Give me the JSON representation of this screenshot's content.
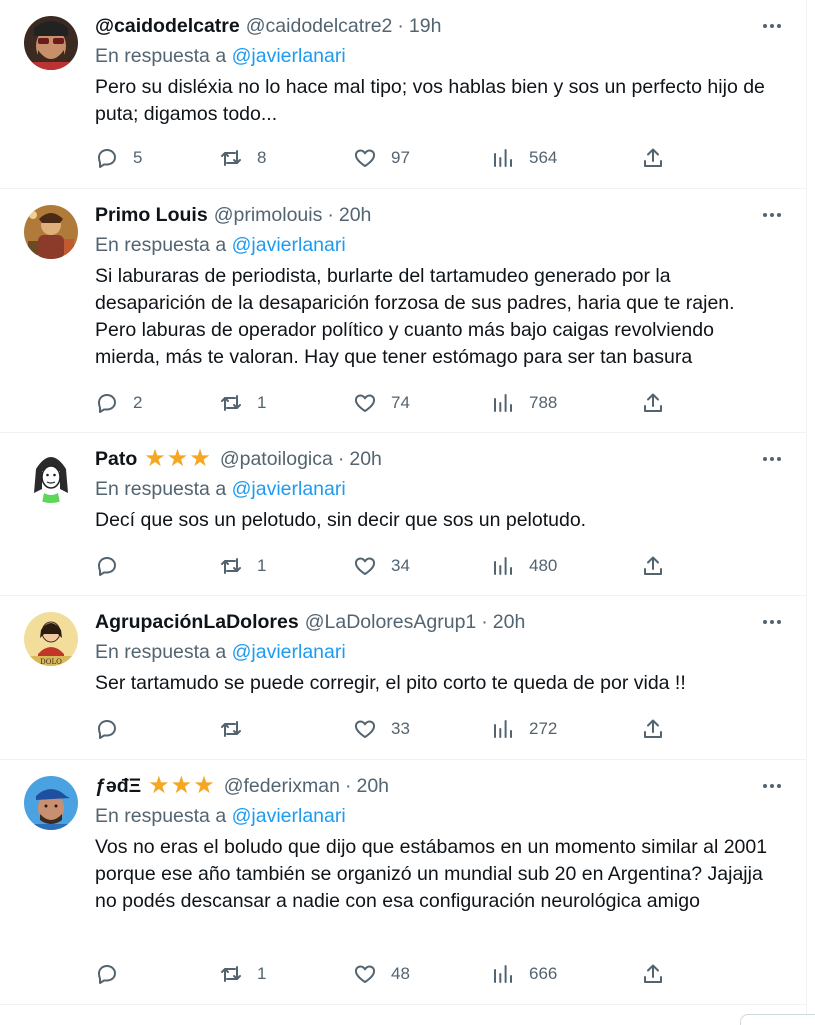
{
  "reply_prefix": "En respuesta a",
  "reply_target": "@javierlanari",
  "tweets": [
    {
      "name": "@caidodelcatre",
      "handle": "@caidodelcatre2",
      "time": "19h",
      "stars": 0,
      "text": "Pero su disléxia no lo hace mal tipo; vos hablas bien y sos un perfecto hijo de puta; digamos todo...",
      "replies": "5",
      "retweets": "8",
      "likes": "97",
      "views": "564",
      "avatar_icon": "man-with-beard-avatar"
    },
    {
      "name": "Primo Louis",
      "handle": "@primolouis",
      "time": "20h",
      "stars": 0,
      "text": "Si laburaras de periodista, burlarte del tartamudeo generado por la desaparición de la desaparición forzosa de sus padres, haria que te rajen. Pero laburas de operador político y cuanto más bajo caigas revolviendo mierda, más te valoran. Hay que tener estómago para ser tan basura",
      "replies": "2",
      "retweets": "1",
      "likes": "74",
      "views": "788",
      "avatar_icon": "illustrated-figure-avatar"
    },
    {
      "name": "Pato",
      "handle": "@patoilogica",
      "time": "20h",
      "stars": 3,
      "text": "Decí que sos un pelotudo, sin decir que sos un pelotudo.",
      "replies": "",
      "retweets": "1",
      "likes": "34",
      "views": "480",
      "avatar_icon": "drawn-woman-avatar"
    },
    {
      "name": "AgrupaciónLaDolores",
      "handle": "@LaDoloresAgrup1",
      "time": "20h",
      "stars": 0,
      "text": "Ser tartamudo se puede corregir, el pito corto te queda de por vida !!",
      "replies": "",
      "retweets": "",
      "likes": "33",
      "views": "272",
      "avatar_icon": "la-dolores-logo-avatar"
    },
    {
      "name": "ƒəđΞ",
      "handle": "@federixman",
      "time": "20h",
      "stars": 3,
      "text": "Vos no eras el boludo que dijo que estábamos en un momento similar al 2001 porque ese año también se organizó un mundial sub 20 en Argentina? Jajajja no podés descansar a nadie con esa configuración neurológica amigo",
      "replies": "",
      "retweets": "1",
      "likes": "48",
      "views": "666",
      "avatar_icon": "man-with-cap-avatar"
    }
  ],
  "colors": {
    "text": "#0f1419",
    "secondary": "#536471",
    "mention": "#1d9bf0",
    "star": "#f5a623",
    "divider": "#eff3f4"
  }
}
